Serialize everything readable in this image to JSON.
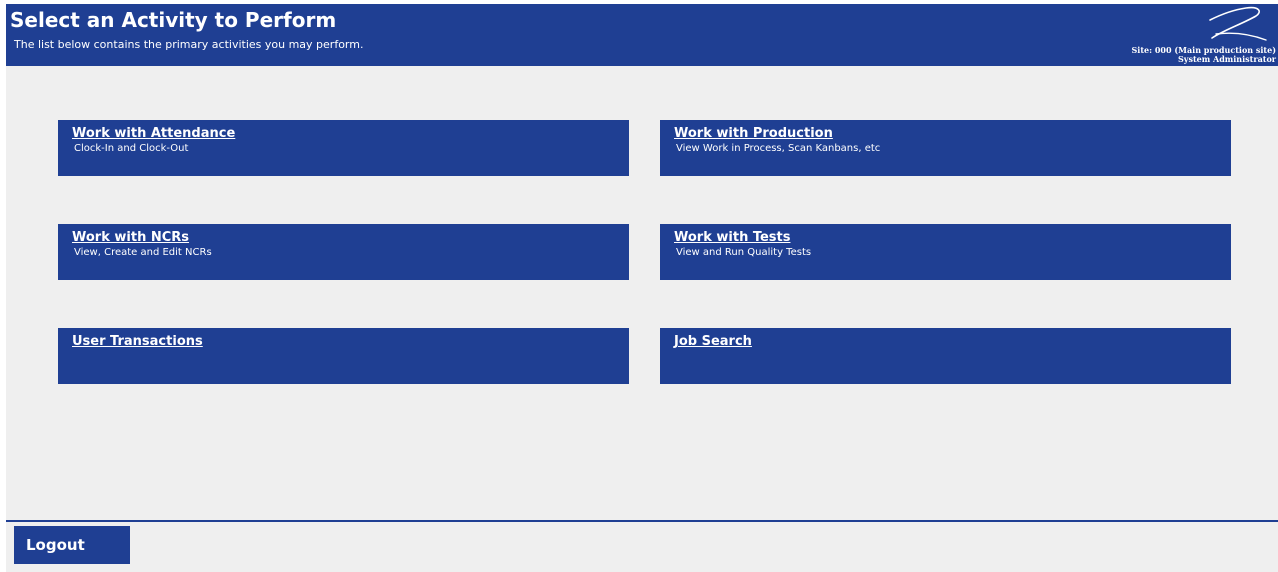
{
  "header": {
    "title": "Select an Activity to Perform",
    "subtitle": "The list below contains the primary activities you may perform.",
    "site": "Site: 000 (Main production site)",
    "user": "System Administrator",
    "logo_icon": "signature-logo-icon"
  },
  "activities": [
    {
      "title": "Work with Attendance",
      "description": "Clock-In and Clock-Out"
    },
    {
      "title": "Work with Production",
      "description": "View Work in Process, Scan Kanbans, etc"
    },
    {
      "title": "Work with NCRs",
      "description": "View, Create and Edit NCRs"
    },
    {
      "title": "Work with Tests",
      "description": "View and Run Quality Tests"
    },
    {
      "title": "User Transactions",
      "description": ""
    },
    {
      "title": "Job Search",
      "description": ""
    }
  ],
  "footer": {
    "logout_label": "Logout"
  },
  "colors": {
    "brand": "#1f3f93",
    "background": "#efefef",
    "text_on_brand": "#ffffff"
  }
}
